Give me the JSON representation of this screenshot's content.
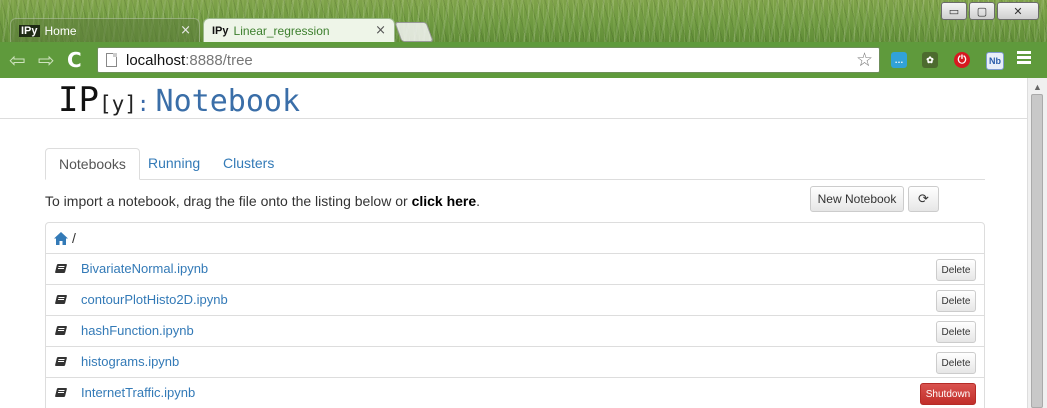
{
  "browser": {
    "tabs": [
      {
        "favicon": "IPy",
        "label": "Home",
        "active": false
      },
      {
        "favicon": "IPy",
        "label": "Linear_regression",
        "active": true
      }
    ],
    "tab_close_glyph": "×",
    "url_host": "localhost",
    "url_rest": ":8888/tree",
    "window_controls": {
      "minimize": "▭",
      "maximize": "▢",
      "close": "✕"
    },
    "extensions": [
      {
        "icon": "chat-extension-icon",
        "glyph": "…"
      },
      {
        "icon": "leaf-extension-icon",
        "glyph": "✿"
      },
      {
        "icon": "power-extension-icon",
        "glyph": "⏻"
      },
      {
        "icon": "nb-extension-icon",
        "glyph": "Nb"
      }
    ]
  },
  "header": {
    "logo_ip": "IP",
    "logo_y": "[y]",
    "logo_colon": ":",
    "title": "Notebook"
  },
  "tabs": [
    {
      "label": "Notebooks",
      "active": true
    },
    {
      "label": "Running",
      "active": false
    },
    {
      "label": "Clusters",
      "active": false
    }
  ],
  "import": {
    "text": "To import a notebook, drag the file onto the listing below or ",
    "link": "click here",
    "suffix": ".",
    "new_notebook_label": "New Notebook"
  },
  "breadcrumb": {
    "path": "/"
  },
  "notebooks": [
    {
      "name": "BivariateNormal.ipynb",
      "action": "Delete"
    },
    {
      "name": "contourPlotHisto2D.ipynb",
      "action": "Delete"
    },
    {
      "name": "hashFunction.ipynb",
      "action": "Delete"
    },
    {
      "name": "histograms.ipynb",
      "action": "Delete"
    },
    {
      "name": "InternetTraffic.ipynb",
      "action": "Shutdown"
    }
  ],
  "colors": {
    "chrome_green": "#5f9a3c",
    "link_blue": "#337ab7",
    "logo_blue": "#3a6ea8",
    "shutdown_red": "#d9534f"
  }
}
